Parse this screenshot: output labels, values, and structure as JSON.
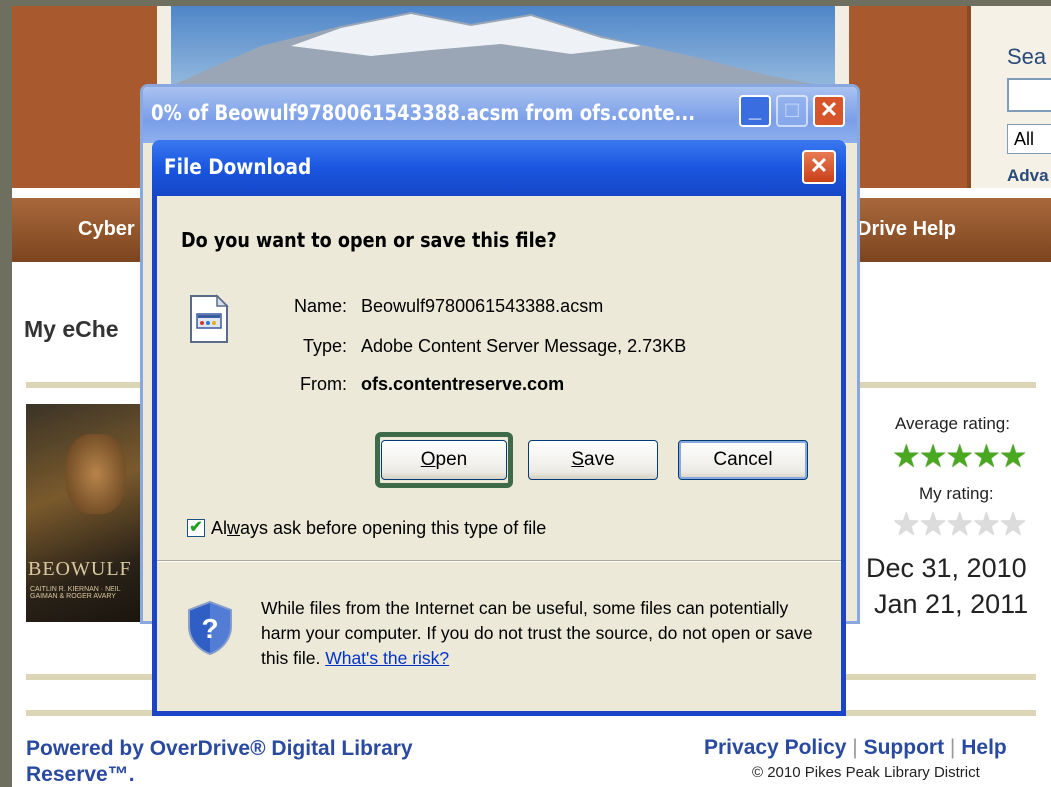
{
  "page": {
    "search_label": "Sea",
    "search_select_value": "All",
    "advanced_link": "Adva",
    "nav_left": "Cyber",
    "nav_right": "Drive Help",
    "section_title": "My eChe",
    "book_cover_title": "BEOWULF",
    "book_cover_author": "CAITLIN R. KIERNAN · NEIL GAIMAN & ROGER AVARY",
    "average_rating_label": "Average rating:",
    "average_rating": 5,
    "average_stars": "★★★★★",
    "my_rating_label": "My rating:",
    "my_rating": 0,
    "my_stars": "★★★★★",
    "date_1": "Dec 31, 2010",
    "date_2": "Jan 21, 2011",
    "footer_powered": "Powered by OverDrive® Digital Library Reserve™.",
    "footer_privacy": "Privacy Policy",
    "footer_support": "Support",
    "footer_help": "Help",
    "footer_sep": "|",
    "copyright": "© 2010 Pikes Peak Library District"
  },
  "progress_window": {
    "title": "0% of Beowulf9780061543388.acsm from ofs.conte...",
    "minimize_glyph": "_",
    "maximize_glyph": "□",
    "close_glyph": "✕"
  },
  "dialog": {
    "title": "File Download",
    "close_glyph": "✕",
    "question": "Do you want to open or save this file?",
    "name_label": "Name:",
    "name_value": "Beowulf9780061543388.acsm",
    "type_label": "Type:",
    "type_value": "Adobe Content Server Message, 2.73KB",
    "from_label": "From:",
    "from_value": "ofs.contentreserve.com",
    "open_mnemonic": "O",
    "open_rest": "pen",
    "save_mnemonic": "S",
    "save_rest": "ave",
    "cancel_label": "Cancel",
    "always_ask_checked": true,
    "checkbox_glyph": "✔",
    "always_ask_pre": "Al",
    "always_ask_mnemonic": "w",
    "always_ask_post": "ays ask before opening this type of file",
    "warning_text": "While files from the Internet can be useful, some files can potentially harm your computer. If you do not trust the source, do not open or save this file. ",
    "risk_link": "What's the risk?"
  },
  "colors": {
    "header_brown": "#a85a2e",
    "xp_blue": "#1c45c6",
    "dialog_face": "#ece9d8",
    "link_blue": "#2a4aa0",
    "star_green": "#4aa820",
    "highlight_green": "#3f6a4a"
  }
}
